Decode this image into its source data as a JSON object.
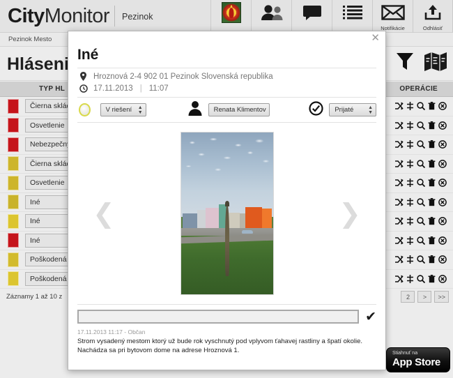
{
  "header": {
    "logo_bold": "City",
    "logo_thin": "Monitor",
    "city": "Pezinok",
    "subtitle": "Pezinok Mesto",
    "nav": [
      {
        "icon": "crest-icon",
        "label": ""
      },
      {
        "icon": "users-icon",
        "label": ""
      },
      {
        "icon": "speech-bubble-icon",
        "label": ""
      },
      {
        "icon": "list-icon",
        "label": ""
      },
      {
        "icon": "envelope-icon",
        "label": "Notifikácie"
      },
      {
        "icon": "upload-icon",
        "label": "Odhlásiť"
      }
    ]
  },
  "page": {
    "title": "Hlásenia",
    "tools": [
      {
        "icon": "filter-funnel-icon"
      },
      {
        "icon": "map-icon"
      }
    ]
  },
  "table": {
    "columns": [
      "TYP HL",
      "OPERÁCIE"
    ],
    "ops_icons": [
      "shuffle-icon",
      "merge-icon",
      "magnifier-icon",
      "trash-icon",
      "cancel-circle-icon"
    ],
    "rows": [
      {
        "priority_color": "#c5141b",
        "type": "Čierna skládk"
      },
      {
        "priority_color": "#c5141b",
        "type": "Osvetlenie"
      },
      {
        "priority_color": "#c5141b",
        "type": "Nebezpečný t"
      },
      {
        "priority_color": "#cdb52c",
        "type": "Čierna skládk"
      },
      {
        "priority_color": "#cdb52c",
        "type": "Osvetlenie"
      },
      {
        "priority_color": "#c9b32b",
        "type": "Iné"
      },
      {
        "priority_color": "#dcc52f",
        "type": "Iné"
      },
      {
        "priority_color": "#c5141b",
        "type": "Iné"
      },
      {
        "priority_color": "#d2bb2d",
        "type": "Poškodená ko"
      },
      {
        "priority_color": "#dcc52f",
        "type": "Poškodená ko"
      }
    ],
    "footer_text": "Záznamy 1 až 10 z",
    "pager": [
      "2",
      ">",
      ">>"
    ]
  },
  "appstore": {
    "small": "Stiahnuť na",
    "big": "App Store"
  },
  "modal": {
    "close": "✕",
    "title": "Iné",
    "address": "Hroznová 2-4 902 01 Pezinok Slovenská republika",
    "date": "17.11.2013",
    "date_separator": "|",
    "time": "11:07",
    "status_select": "V riešení",
    "person_select": "Renata Klimentov",
    "state_select": "Prijaté",
    "arrow_prev": "❮",
    "arrow_next": "❯",
    "comment_placeholder": "",
    "comment_value": "",
    "submit_check": "✔",
    "comment_meta": "17.11.2013 11:17 - Občan",
    "comment_body": "Strom vysadený mestom ktorý už bude rok vyschnutý pod vplyvom ťahavej rastliny a špatí okolie. Nachádza sa pri bytovom dome na adrese Hroznová 1."
  },
  "colors": {
    "accent_red": "#c5141b",
    "accent_yellow": "#dcc52f",
    "chrome": "#e3e3e3"
  }
}
